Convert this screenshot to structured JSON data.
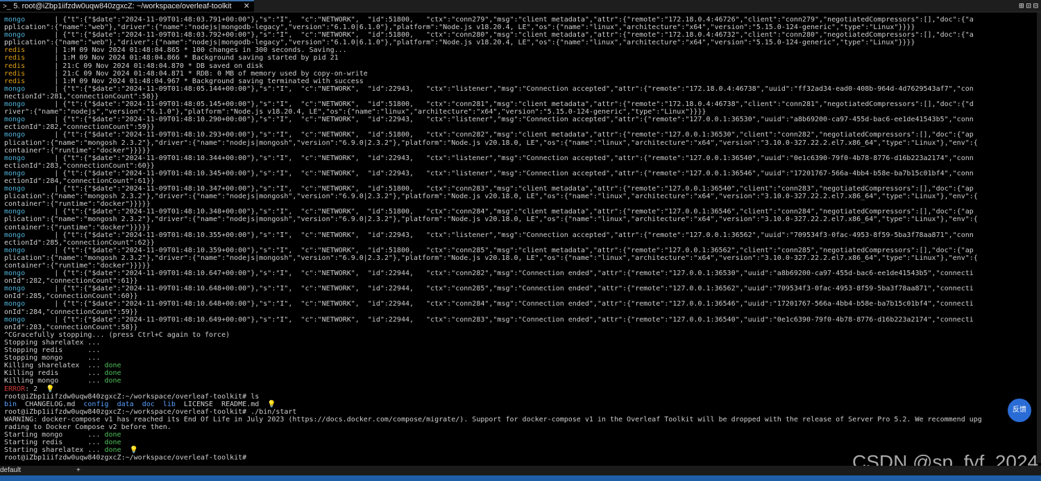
{
  "tab": {
    "icon": ">_",
    "title": "5. root@iZbp1iifzdw0uqw840zgxcZ: ~/workspace/overleaf-toolkit",
    "close": "✕"
  },
  "window_controls": [
    "⊞",
    "⊡",
    "⊟"
  ],
  "terminal": {
    "lines": [
      [
        [
          "mongo",
          "svc-mongo"
        ],
        [
          "       | {\"t\":{\"$date\":\"2024-11-09T01:48:03.791+00:00\"},\"s\":\"I\",  \"c\":\"NETWORK\",  \"id\":51800,   \"ctx\":\"conn279\",\"msg\":\"client metadata\",\"attr\":{\"remote\":\"172.18.0.4:46726\",\"client\":\"conn279\",\"negotiatedCompressors\":[],\"doc\":{\"a",
          ""
        ]
      ],
      [
        [
          "pplication\":{\"name\":\"web\"},\"driver\":{\"name\":\"nodejs|mongodb-legacy\",\"version\":\"6.1.0|6.1.0\"},\"platform\":\"Node.js v18.20.4, LE\",\"os\":{\"name\":\"linux\",\"architecture\":\"x64\",\"version\":\"5.15.0-124-generic\",\"type\":\"Linux\"}}}}",
          ""
        ]
      ],
      [
        [
          "mongo",
          "svc-mongo"
        ],
        [
          "       | {\"t\":{\"$date\":\"2024-11-09T01:48:03.792+00:00\"},\"s\":\"I\",  \"c\":\"NETWORK\",  \"id\":51800,   \"ctx\":\"conn280\",\"msg\":\"client metadata\",\"attr\":{\"remote\":\"172.18.0.4:46732\",\"client\":\"conn280\",\"negotiatedCompressors\":[],\"doc\":{\"a",
          ""
        ]
      ],
      [
        [
          "pplication\":{\"name\":\"web\"},\"driver\":{\"name\":\"nodejs|mongodb-legacy\",\"version\":\"6.1.0|6.1.0\"},\"platform\":\"Node.js v18.20.4, LE\",\"os\":{\"name\":\"linux\",\"architecture\":\"x64\",\"version\":\"5.15.0-124-generic\",\"type\":\"Linux\"}}}}",
          ""
        ]
      ],
      [
        [
          "redis",
          "svc-redis"
        ],
        [
          "       | 1:M 09 Nov 2024 01:48:04.865 * 100 changes in 300 seconds. Saving...",
          ""
        ]
      ],
      [
        [
          "redis",
          "svc-redis"
        ],
        [
          "       | 1:M 09 Nov 2024 01:48:04.866 * Background saving started by pid 21",
          ""
        ]
      ],
      [
        [
          "redis",
          "svc-redis"
        ],
        [
          "       | 21:C 09 Nov 2024 01:48:04.870 * DB saved on disk",
          ""
        ]
      ],
      [
        [
          "redis",
          "svc-redis"
        ],
        [
          "       | 21:C 09 Nov 2024 01:48:04.871 * RDB: 0 MB of memory used by copy-on-write",
          ""
        ]
      ],
      [
        [
          "redis",
          "svc-redis"
        ],
        [
          "       | 1:M 09 Nov 2024 01:48:04.967 * Background saving terminated with success",
          ""
        ]
      ],
      [
        [
          "mongo",
          "svc-mongo"
        ],
        [
          "       | {\"t\":{\"$date\":\"2024-11-09T01:48:05.144+00:00\"},\"s\":\"I\",  \"c\":\"NETWORK\",  \"id\":22943,   \"ctx\":\"listener\",\"msg\":\"Connection accepted\",\"attr\":{\"remote\":\"172.18.0.4:46738\",\"uuid\":\"ff32ad34-ead0-408b-964d-4d7629543af7\",\"con",
          ""
        ]
      ],
      [
        [
          "nectionId\":281,\"connectionCount\":58}}",
          ""
        ]
      ],
      [
        [
          "mongo",
          "svc-mongo"
        ],
        [
          "       | {\"t\":{\"$date\":\"2024-11-09T01:48:05.145+00:00\"},\"s\":\"I\",  \"c\":\"NETWORK\",  \"id\":51800,   \"ctx\":\"conn281\",\"msg\":\"client metadata\",\"attr\":{\"remote\":\"172.18.0.4:46738\",\"client\":\"conn281\",\"negotiatedCompressors\":[],\"doc\":{\"d",
          ""
        ]
      ],
      [
        [
          "river\":{\"name\":\"nodejs\",\"version\":\"6.1.0\"},\"platform\":\"Node.js v18.20.4, LE\",\"os\":{\"name\":\"linux\",\"architecture\":\"x64\",\"version\":\"5.15.0-124-generic\",\"type\":\"Linux\"}}}}",
          ""
        ]
      ],
      [
        [
          "mongo",
          "svc-mongo"
        ],
        [
          "       | {\"t\":{\"$date\":\"2024-11-09T01:48:10.290+00:00\"},\"s\":\"I\",  \"c\":\"NETWORK\",  \"id\":22943,   \"ctx\":\"listener\",\"msg\":\"Connection accepted\",\"attr\":{\"remote\":\"127.0.0.1:36530\",\"uuid\":\"a8b69200-ca97-455d-bac6-ee1de41543b5\",\"conn",
          ""
        ]
      ],
      [
        [
          "ectionId\":282,\"connectionCount\":59}}",
          ""
        ]
      ],
      [
        [
          "mongo",
          "svc-mongo"
        ],
        [
          "       | {\"t\":{\"$date\":\"2024-11-09T01:48:10.293+00:00\"},\"s\":\"I\",  \"c\":\"NETWORK\",  \"id\":51800,   \"ctx\":\"conn282\",\"msg\":\"client metadata\",\"attr\":{\"remote\":\"127.0.0.1:36530\",\"client\":\"conn282\",\"negotiatedCompressors\":[],\"doc\":{\"ap",
          ""
        ]
      ],
      [
        [
          "plication\":{\"name\":\"mongosh 2.3.2\"},\"driver\":{\"name\":\"nodejs|mongosh\",\"version\":\"6.9.0|2.3.2\"},\"platform\":\"Node.js v20.18.0, LE\",\"os\":{\"name\":\"linux\",\"architecture\":\"x64\",\"version\":\"3.10.0-327.22.2.el7.x86_64\",\"type\":\"Linux\"},\"env\":{",
          ""
        ]
      ],
      [
        [
          "container\":{\"runtime\":\"docker\"}}}}}",
          ""
        ]
      ],
      [
        [
          "mongo",
          "svc-mongo"
        ],
        [
          "       | {\"t\":{\"$date\":\"2024-11-09T01:48:10.344+00:00\"},\"s\":\"I\",  \"c\":\"NETWORK\",  \"id\":22943,   \"ctx\":\"listener\",\"msg\":\"Connection accepted\",\"attr\":{\"remote\":\"127.0.0.1:36540\",\"uuid\":\"0e1c6390-79f0-4b78-8776-d16b223a2174\",\"conn",
          ""
        ]
      ],
      [
        [
          "ectionId\":283,\"connectionCount\":60}}",
          ""
        ]
      ],
      [
        [
          "mongo",
          "svc-mongo"
        ],
        [
          "       | {\"t\":{\"$date\":\"2024-11-09T01:48:10.345+00:00\"},\"s\":\"I\",  \"c\":\"NETWORK\",  \"id\":22943,   \"ctx\":\"listener\",\"msg\":\"Connection accepted\",\"attr\":{\"remote\":\"127.0.0.1:36546\",\"uuid\":\"17201767-566a-4bb4-b58e-ba7b15c01bf4\",\"conn",
          ""
        ]
      ],
      [
        [
          "ectionId\":284,\"connectionCount\":61}}",
          ""
        ]
      ],
      [
        [
          "mongo",
          "svc-mongo"
        ],
        [
          "       | {\"t\":{\"$date\":\"2024-11-09T01:48:10.347+00:00\"},\"s\":\"I\",  \"c\":\"NETWORK\",  \"id\":51800,   \"ctx\":\"conn283\",\"msg\":\"client metadata\",\"attr\":{\"remote\":\"127.0.0.1:36540\",\"client\":\"conn283\",\"negotiatedCompressors\":[],\"doc\":{\"ap",
          ""
        ]
      ],
      [
        [
          "plication\":{\"name\":\"mongosh 2.3.2\"},\"driver\":{\"name\":\"nodejs|mongosh\",\"version\":\"6.9.0|2.3.2\"},\"platform\":\"Node.js v20.18.0, LE\",\"os\":{\"name\":\"linux\",\"architecture\":\"x64\",\"version\":\"3.10.0-327.22.2.el7.x86_64\",\"type\":\"Linux\"},\"env\":{",
          ""
        ]
      ],
      [
        [
          "container\":{\"runtime\":\"docker\"}}}}}",
          ""
        ]
      ],
      [
        [
          "mongo",
          "svc-mongo"
        ],
        [
          "       | {\"t\":{\"$date\":\"2024-11-09T01:48:10.348+00:00\"},\"s\":\"I\",  \"c\":\"NETWORK\",  \"id\":51800,   \"ctx\":\"conn284\",\"msg\":\"client metadata\",\"attr\":{\"remote\":\"127.0.0.1:36546\",\"client\":\"conn284\",\"negotiatedCompressors\":[],\"doc\":{\"ap",
          ""
        ]
      ],
      [
        [
          "plication\":{\"name\":\"mongosh 2.3.2\"},\"driver\":{\"name\":\"nodejs|mongosh\",\"version\":\"6.9.0|2.3.2\"},\"platform\":\"Node.js v20.18.0, LE\",\"os\":{\"name\":\"linux\",\"architecture\":\"x64\",\"version\":\"3.10.0-327.22.2.el7.x86_64\",\"type\":\"Linux\"},\"env\":{",
          ""
        ]
      ],
      [
        [
          "container\":{\"runtime\":\"docker\"}}}}}",
          ""
        ]
      ],
      [
        [
          "mongo",
          "svc-mongo"
        ],
        [
          "       | {\"t\":{\"$date\":\"2024-11-09T01:48:10.355+00:00\"},\"s\":\"I\",  \"c\":\"NETWORK\",  \"id\":22943,   \"ctx\":\"listener\",\"msg\":\"Connection accepted\",\"attr\":{\"remote\":\"127.0.0.1:36562\",\"uuid\":\"709534f3-0fac-4953-8f59-5ba3f78aa871\",\"conn",
          ""
        ]
      ],
      [
        [
          "ectionId\":285,\"connectionCount\":62}}",
          ""
        ]
      ],
      [
        [
          "mongo",
          "svc-mongo"
        ],
        [
          "       | {\"t\":{\"$date\":\"2024-11-09T01:48:10.359+00:00\"},\"s\":\"I\",  \"c\":\"NETWORK\",  \"id\":51800,   \"ctx\":\"conn285\",\"msg\":\"client metadata\",\"attr\":{\"remote\":\"127.0.0.1:36562\",\"client\":\"conn285\",\"negotiatedCompressors\":[],\"doc\":{\"ap",
          ""
        ]
      ],
      [
        [
          "plication\":{\"name\":\"mongosh 2.3.2\"},\"driver\":{\"name\":\"nodejs|mongosh\",\"version\":\"6.9.0|2.3.2\"},\"platform\":\"Node.js v20.18.0, LE\",\"os\":{\"name\":\"linux\",\"architecture\":\"x64\",\"version\":\"3.10.0-327.22.2.el7.x86_64\",\"type\":\"Linux\"},\"env\":{",
          ""
        ]
      ],
      [
        [
          "container\":{\"runtime\":\"docker\"}}}}}",
          ""
        ]
      ],
      [
        [
          "mongo",
          "svc-mongo"
        ],
        [
          "       | {\"t\":{\"$date\":\"2024-11-09T01:48:10.647+00:00\"},\"s\":\"I\",  \"c\":\"NETWORK\",  \"id\":22944,   \"ctx\":\"conn282\",\"msg\":\"Connection ended\",\"attr\":{\"remote\":\"127.0.0.1:36530\",\"uuid\":\"a8b69200-ca97-455d-bac6-ee1de41543b5\",\"connecti",
          ""
        ]
      ],
      [
        [
          "onId\":282,\"connectionCount\":61}}",
          ""
        ]
      ],
      [
        [
          "mongo",
          "svc-mongo"
        ],
        [
          "       | {\"t\":{\"$date\":\"2024-11-09T01:48:10.648+00:00\"},\"s\":\"I\",  \"c\":\"NETWORK\",  \"id\":22944,   \"ctx\":\"conn285\",\"msg\":\"Connection ended\",\"attr\":{\"remote\":\"127.0.0.1:36562\",\"uuid\":\"709534f3-0fac-4953-8f59-5ba3f78aa871\",\"connecti",
          ""
        ]
      ],
      [
        [
          "onId\":285,\"connectionCount\":60}}",
          ""
        ]
      ],
      [
        [
          "mongo",
          "svc-mongo"
        ],
        [
          "       | {\"t\":{\"$date\":\"2024-11-09T01:48:10.648+00:00\"},\"s\":\"I\",  \"c\":\"NETWORK\",  \"id\":22944,   \"ctx\":\"conn284\",\"msg\":\"Connection ended\",\"attr\":{\"remote\":\"127.0.0.1:36546\",\"uuid\":\"17201767-566a-4bb4-b58e-ba7b15c01bf4\",\"connecti",
          ""
        ]
      ],
      [
        [
          "onId\":284,\"connectionCount\":59}}",
          ""
        ]
      ],
      [
        [
          "mongo",
          "svc-mongo"
        ],
        [
          "       | {\"t\":{\"$date\":\"2024-11-09T01:48:10.649+00:00\"},\"s\":\"I\",  \"c\":\"NETWORK\",  \"id\":22944,   \"ctx\":\"conn283\",\"msg\":\"Connection ended\",\"attr\":{\"remote\":\"127.0.0.1:36540\",\"uuid\":\"0e1c6390-79f0-4b78-8776-d16b223a2174\",\"connecti",
          ""
        ]
      ],
      [
        [
          "onId\":283,\"connectionCount\":58}}",
          ""
        ]
      ],
      [
        [
          "^CGracefully stopping... (press Ctrl+C again to force)",
          ""
        ]
      ],
      [
        [
          "Stopping sharelatex ...",
          ""
        ]
      ],
      [
        [
          "Stopping redis      ...",
          ""
        ]
      ],
      [
        [
          "Stopping mongo      ...",
          ""
        ]
      ],
      [
        [
          "Killing sharelatex  ... ",
          ""
        ],
        [
          "done",
          "done"
        ]
      ],
      [
        [
          "Killing redis       ... ",
          ""
        ],
        [
          "done",
          "done"
        ]
      ],
      [
        [
          "Killing mongo       ... ",
          ""
        ],
        [
          "done",
          "done"
        ]
      ],
      [
        [
          "ERROR",
          "err"
        ],
        [
          ": 2  ",
          ""
        ],
        [
          "💡",
          "bulb"
        ]
      ],
      [
        [
          "root@iZbp1iifzdw0uqw840zgxcZ:~/workspace/overleaf-toolkit# ls",
          ""
        ]
      ],
      [
        [
          "bin",
          "dir"
        ],
        [
          "  CHANGELOG.md  ",
          ""
        ],
        [
          "config",
          "dir"
        ],
        [
          "  ",
          ""
        ],
        [
          "data",
          "dir"
        ],
        [
          "  ",
          ""
        ],
        [
          "doc",
          "dir"
        ],
        [
          "  ",
          ""
        ],
        [
          "lib",
          "dir"
        ],
        [
          "  LICENSE  README.md  ",
          ""
        ],
        [
          "💡",
          "bulb"
        ]
      ],
      [
        [
          "root@iZbp1iifzdw0uqw840zgxcZ:~/workspace/overleaf-toolkit# ./bin/start",
          ""
        ]
      ],
      [
        [
          "WARNING: docker-compose v1 has reached its End Of Life in July 2023 (https://docs.docker.com/compose/migrate/). Support for docker-compose v1 in the Overleaf Toolkit will be dropped with the release of Server Pro 5.2. We recommend upg",
          ""
        ]
      ],
      [
        [
          "rading to Docker Compose v2 before then.",
          ""
        ]
      ],
      [
        [
          "Starting mongo      ... ",
          ""
        ],
        [
          "done",
          "done"
        ]
      ],
      [
        [
          "Starting redis      ... ",
          ""
        ],
        [
          "done",
          "done"
        ]
      ],
      [
        [
          "Starting sharelatex ... ",
          ""
        ],
        [
          "done",
          "done"
        ],
        [
          "  ",
          ""
        ],
        [
          "💡",
          "bulb"
        ]
      ],
      [
        [
          "root@iZbp1iifzdw0uqw840zgxcZ:~/workspace/overleaf-toolkit#",
          ""
        ]
      ]
    ]
  },
  "float_button_label": "反馈",
  "watermark": "CSDN @sp_fyf_2024",
  "bottom_bar": {
    "profile": "default",
    "add": "+"
  },
  "colors": {
    "mongo": "#4fb3d9",
    "redis": "#e0a010",
    "error": "#d23b3b",
    "done": "#4fc05a",
    "dir": "#5aa0ff",
    "status_bar": "#1f5faa"
  }
}
